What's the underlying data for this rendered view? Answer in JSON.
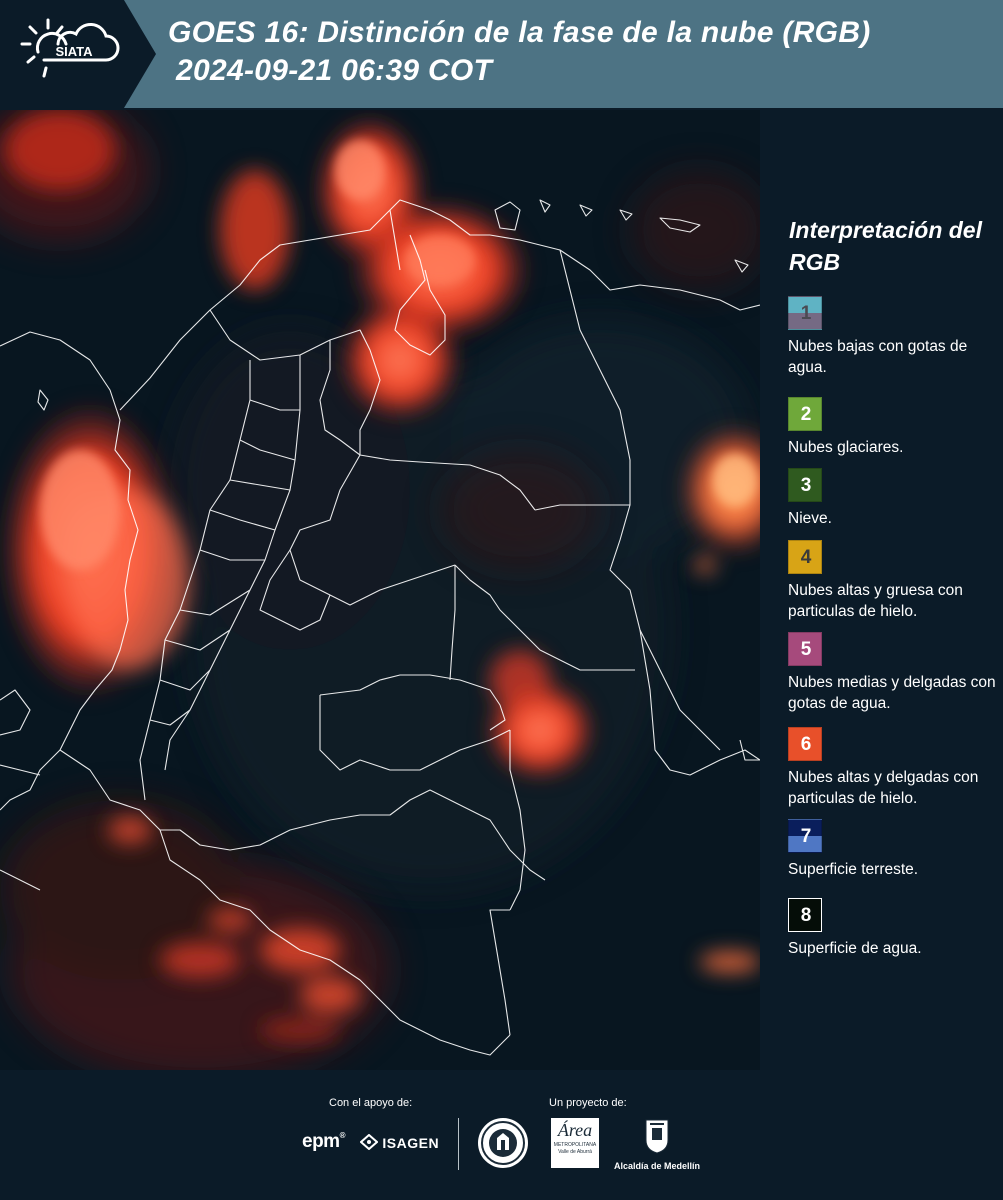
{
  "header": {
    "logo_text": "SIATA",
    "title_line1": "GOES 16: Distinción de la fase de la nube (RGB)",
    "title_line2": "2024-09-21 06:39 COT",
    "background_color": "#4d7384"
  },
  "legend": {
    "title": "Interpretación del RGB",
    "items": [
      {
        "number": "1",
        "label": "Nubes bajas con gotas de agua.",
        "color_top": "#5fb3c4",
        "color_bottom": "#756a84",
        "num_color": "#4a4a52"
      },
      {
        "number": "2",
        "label": "Nubes glaciares.",
        "color_top": "#6fa83a",
        "color_bottom": "#6fa83a",
        "num_color": "#ffffff"
      },
      {
        "number": "3",
        "label": "Nieve.",
        "color_top": "#2f5a1f",
        "color_bottom": "#2f5a1f",
        "num_color": "#ffffff"
      },
      {
        "number": "4",
        "label": "Nubes altas y gruesa con particulas de hielo.",
        "color_top": "#d8a416",
        "color_bottom": "#d8a416",
        "num_color": "#3a3a3a"
      },
      {
        "number": "5",
        "label": "Nubes medias y delgadas con gotas de agua.",
        "color_top": "#a64a7c",
        "color_bottom": "#a64a7c",
        "num_color": "#ffffff"
      },
      {
        "number": "6",
        "label": "Nubes altas y delgadas con particulas de hielo.",
        "color_top": "#e8502a",
        "color_bottom": "#e8502a",
        "num_color": "#ffffff"
      },
      {
        "number": "7",
        "label": "Superficie terreste.",
        "color_top": "#0a1e5c",
        "color_bottom": "#4f77c4",
        "num_color": "#ffffff"
      },
      {
        "number": "8",
        "label": "Superficie de agua.",
        "color_top": "#050d08",
        "color_bottom": "#050d08",
        "num_color": "#ffffff"
      }
    ]
  },
  "footer": {
    "support_label": "Con el apoyo de:",
    "project_label": "Un proyecto de:",
    "logos": {
      "epm": "epm",
      "isagen": "ISAGEN",
      "area_name": "Área",
      "area_sub1": "METROPOLITANA",
      "area_sub2": "Valle de Aburrá",
      "alcaldia": "Alcaldía de Medellín"
    }
  }
}
